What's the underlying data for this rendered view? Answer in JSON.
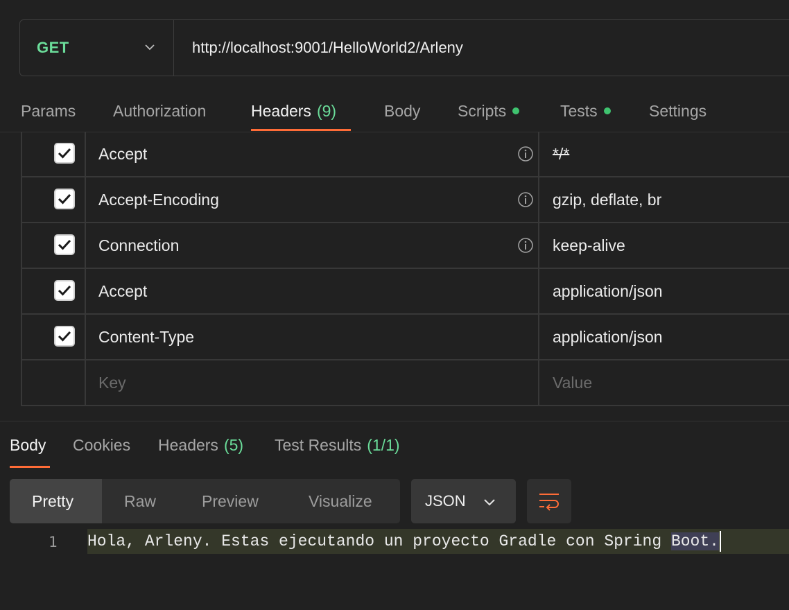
{
  "request": {
    "method": "GET",
    "url": "http://localhost:9001/HelloWorld2/Arleny"
  },
  "request_tabs": [
    {
      "label": "Params"
    },
    {
      "label": "Authorization"
    },
    {
      "label": "Headers",
      "count": "(9)",
      "active": true
    },
    {
      "label": "Body"
    },
    {
      "label": "Scripts",
      "dot": true
    },
    {
      "label": "Tests",
      "dot": true
    },
    {
      "label": "Settings"
    }
  ],
  "headers": [
    {
      "key": "Accept",
      "value": "*/*",
      "checked": true,
      "info": true
    },
    {
      "key": "Accept-Encoding",
      "value": "gzip, deflate, br",
      "checked": true,
      "info": true
    },
    {
      "key": "Connection",
      "value": "keep-alive",
      "checked": true,
      "info": true
    },
    {
      "key": "Accept",
      "value": "application/json",
      "checked": true,
      "info": false
    },
    {
      "key": "Content-Type",
      "value": "application/json",
      "checked": true,
      "info": false
    }
  ],
  "new_header": {
    "key_placeholder": "Key",
    "value_placeholder": "Value"
  },
  "response_tabs": [
    {
      "label": "Body",
      "active": true
    },
    {
      "label": "Cookies"
    },
    {
      "label": "Headers",
      "count": "(5)"
    },
    {
      "label": "Test Results",
      "count": "(1/1)"
    }
  ],
  "view_modes": [
    "Pretty",
    "Raw",
    "Preview",
    "Visualize"
  ],
  "active_view_mode": "Pretty",
  "format": "JSON",
  "response_body": {
    "line_number": "1",
    "text_main": "Hola, Arleny. Estas ejecutando un proyecto Gradle con Spring ",
    "text_selected": "Boot."
  },
  "colors": {
    "accent": "#ff6c37",
    "method_get": "#6bdd9a",
    "status_dot": "#3fc36f",
    "background": "#212121"
  }
}
